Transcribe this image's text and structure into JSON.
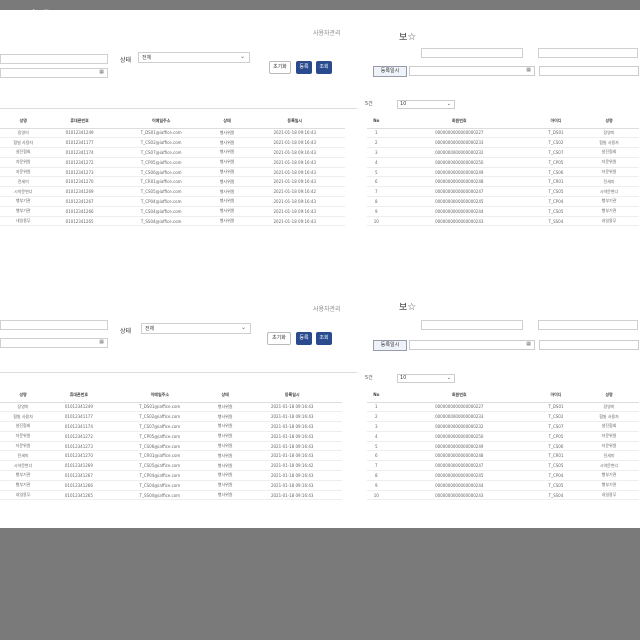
{
  "watermark": "workScr.png",
  "search": {
    "admin_label": "사용자관리",
    "status_label": "상태",
    "status_value": "전체",
    "date_icon": "calendar-icon",
    "reset_label": "초기화",
    "register_label": "등록",
    "search_label": "조회"
  },
  "form": {
    "title": "보",
    "star": "☆",
    "reg_date_label": "등록일시",
    "date_icon": "calendar-icon"
  },
  "page_size": {
    "label": "5건",
    "value": "10"
  },
  "table_a": {
    "headers": [
      "성명",
      "휴대폰번호",
      "이메일주소",
      "상태",
      "등록일시"
    ],
    "rows": [
      [
        "장영미",
        "01012341249",
        "T_DS01@iaffice.com",
        "행사위원",
        "2021-01-18 09:16:43"
      ],
      [
        "협빌 사용자",
        "01012341177",
        "T_CS02@iaffice.com",
        "행사위원",
        "2021-01-18 09:16:43"
      ],
      [
        "설진협회",
        "01012341174",
        "T_CS07@iaffice.com",
        "행사위원",
        "2021-01-18 09:16:43"
      ],
      [
        "자문위원",
        "01012341272",
        "T_CP05@iaffice.com",
        "행사위원",
        "2021-01-18 09:16:43"
      ],
      [
        "자문위원",
        "01012341273",
        "T_CS06@iaffice.com",
        "행사위원",
        "2021-01-18 09:16:43"
      ],
      [
        "전세미",
        "01012341270",
        "T_CR01@iaffice.com",
        "행사위원",
        "2021-01-18 09:16:43"
      ],
      [
        "시약문변너",
        "01012341269",
        "T_CS05@iaffice.com",
        "행사위원",
        "2021-01-18 09:16:42"
      ],
      [
        "행부기관",
        "01012341267",
        "T_CP04@iaffice.com",
        "행사위원",
        "2021-01-18 09:16:43"
      ],
      [
        "행부기관",
        "01012341266",
        "T_CS04@iaffice.com",
        "행사위원",
        "2021-01-18 09:16:43"
      ],
      [
        "내일용무",
        "01012341265",
        "T_SS04@iaffice.com",
        "행사위원",
        "2021-01-18 09:16:43"
      ]
    ]
  },
  "table_b": {
    "headers": [
      "No",
      "회원번호",
      "아이디",
      "성명"
    ],
    "rows": [
      [
        "1",
        "0000000000000000227",
        "T_DS01",
        "장영미"
      ],
      [
        "2",
        "0000000000000000233",
        "T_CS02",
        "협빌 사용자"
      ],
      [
        "3",
        "0000000000000000232",
        "T_CS07",
        "설진협회"
      ],
      [
        "4",
        "0000000000000000250",
        "T_CP05",
        "자문위원"
      ],
      [
        "5",
        "0000000000000000249",
        "T_CS06",
        "자문위원"
      ],
      [
        "6",
        "0000000000000000248",
        "T_CR01",
        "전세미"
      ],
      [
        "7",
        "0000000000000000247",
        "T_CS05",
        "시약문변너"
      ],
      [
        "8",
        "0000000000000000245",
        "T_CP04",
        "행부기관"
      ],
      [
        "9",
        "0000000000000000244",
        "T_CS05",
        "행부기관"
      ],
      [
        "10",
        "0000000000000000243",
        "T_SS04",
        "내일용무"
      ]
    ]
  }
}
